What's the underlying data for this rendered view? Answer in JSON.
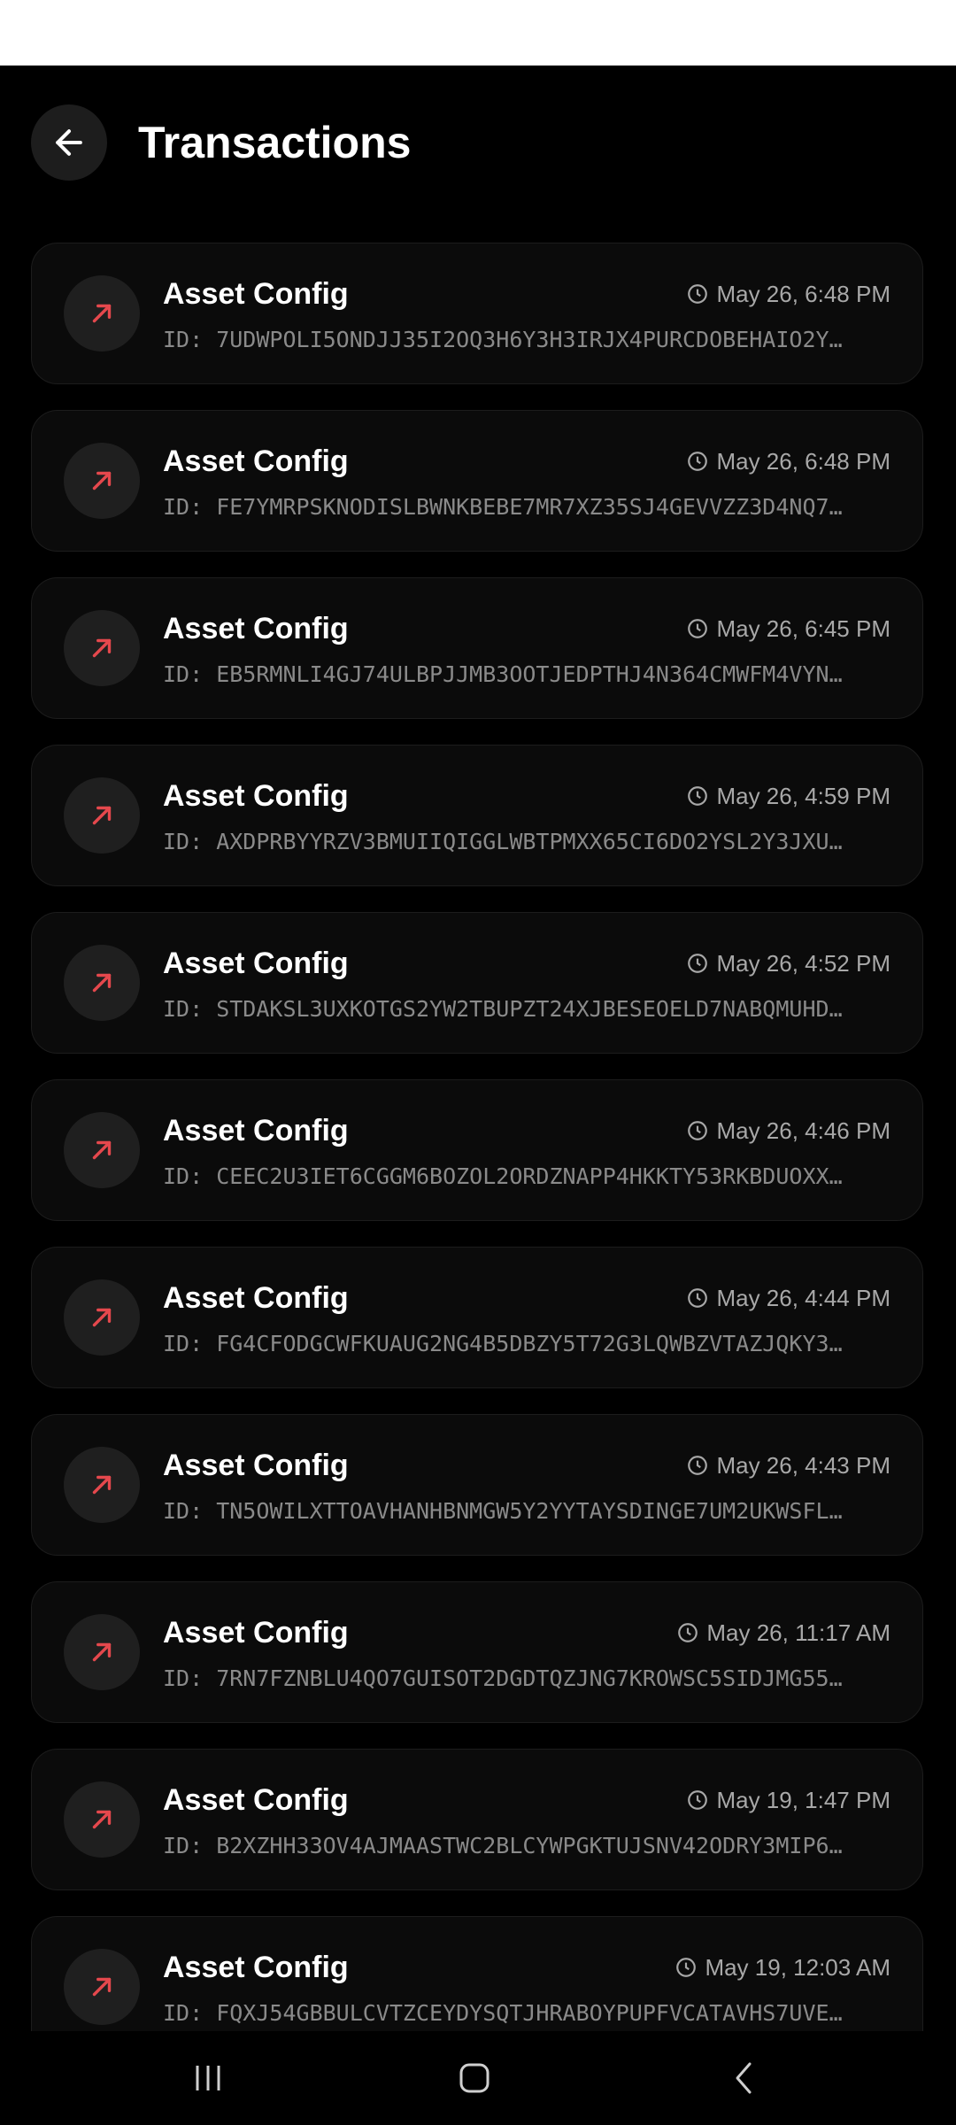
{
  "header": {
    "title": "Transactions",
    "back_icon": "arrow-left-icon"
  },
  "colors": {
    "background": "#000000",
    "card": "#0b0b0b",
    "accent_red": "#e5484d"
  },
  "transactions": [
    {
      "title": "Asset Config",
      "time": "May 26, 6:48 PM",
      "id": "ID: 7UDWPOLI5ONDJJ35I2OQ3H6Y3H3IRJX4PURCDOBEHAIO2Y…"
    },
    {
      "title": "Asset Config",
      "time": "May 26, 6:48 PM",
      "id": "ID: FE7YMRPSKNODISLBWNKBEBE7MR7XZ35SJ4GEVVZZ3D4NQ7…"
    },
    {
      "title": "Asset Config",
      "time": "May 26, 6:45 PM",
      "id": "ID: EB5RMNLI4GJ74ULBPJJMB3OOTJEDPTHJ4N364CMWFM4VYN…"
    },
    {
      "title": "Asset Config",
      "time": "May 26, 4:59 PM",
      "id": "ID: AXDPRBYYRZV3BMUIIQIGGLWBTPMXX65CI6DO2YSL2Y3JXU…"
    },
    {
      "title": "Asset Config",
      "time": "May 26, 4:52 PM",
      "id": "ID: STDAKSL3UXKOTGS2YW2TBUPZT24XJBESEOELD7NABQMUHD…"
    },
    {
      "title": "Asset Config",
      "time": "May 26, 4:46 PM",
      "id": "ID: CEEC2U3IET6CGGM6BOZOL2ORDZNAPP4HKKTY53RKBDUOXX…"
    },
    {
      "title": "Asset Config",
      "time": "May 26, 4:44 PM",
      "id": "ID: FG4CFODGCWFKUAUG2NG4B5DBZY5T72G3LQWBZVTAZJQKY3…"
    },
    {
      "title": "Asset Config",
      "time": "May 26, 4:43 PM",
      "id": "ID: TN5OWILXTTOAVHANHBNMGW5Y2YYTAYSDINGE7UM2UKWSFL…"
    },
    {
      "title": "Asset Config",
      "time": "May 26, 11:17 AM",
      "id": "ID: 7RN7FZNBLU4QO7GUISOT2DGDTQZJNG7KROWSC5SIDJMG55…"
    },
    {
      "title": "Asset Config",
      "time": "May 19, 1:47 PM",
      "id": "ID: B2XZHH33OV4AJMAASTWC2BLCYWPGKTUJSNV42ODRY3MIP6…"
    },
    {
      "title": "Asset Config",
      "time": "May 19, 12:03 AM",
      "id": "ID: FQXJ54GBBULCVTZCEYDYSQTJHRABOYPUPFVCATAVHS7UVE…"
    }
  ],
  "nav": {
    "recents_icon": "recents-icon",
    "home_icon": "home-icon",
    "back_icon": "back-chevron-icon"
  }
}
